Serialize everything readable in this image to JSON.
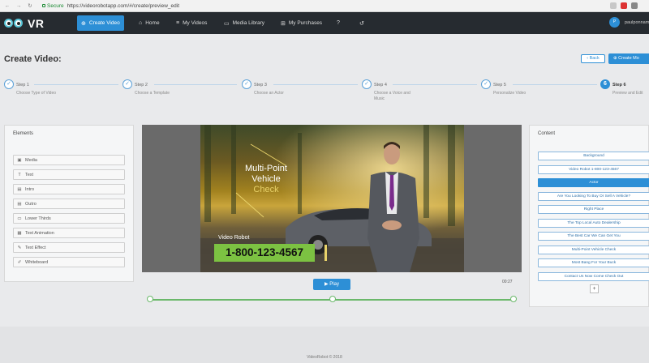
{
  "browser": {
    "secure_label": "Secure",
    "url": "https://videorobotapp.com/#/create/preview_edit"
  },
  "app": {
    "logo_text": "VR",
    "nav": [
      {
        "label": "Create Video",
        "icon": "plus-circle-icon",
        "active": true
      },
      {
        "label": "Home",
        "icon": "home-icon"
      },
      {
        "label": "My Videos",
        "icon": "list-icon"
      },
      {
        "label": "Media Library",
        "icon": "folder-icon"
      },
      {
        "label": "My Purchases",
        "icon": "cart-icon"
      },
      {
        "label": "",
        "icon": "help-icon"
      },
      {
        "label": "",
        "icon": "refresh-icon"
      }
    ],
    "user": {
      "avatar_initial": "P",
      "name": "paulponnam"
    }
  },
  "page": {
    "title": "Create Video:",
    "back_label": "Back",
    "create_label": "Create Mo"
  },
  "steps": [
    {
      "label": "Step 1",
      "desc": "Choose Type of Video",
      "done": true
    },
    {
      "label": "Step 2",
      "desc": "Choose a Template",
      "done": true
    },
    {
      "label": "Step 3",
      "desc": "Choose an Actor",
      "done": true
    },
    {
      "label": "Step 4",
      "desc": "Choose a Voice and Music",
      "done": true
    },
    {
      "label": "Step 5",
      "desc": "Personalize Video",
      "done": true
    },
    {
      "label": "Step 6",
      "number": "6",
      "desc": "Preview and Edit",
      "current": true
    }
  ],
  "elements_panel": {
    "title": "Elements",
    "items": [
      {
        "label": "Media",
        "icon": "image-icon"
      },
      {
        "label": "Text",
        "icon": "text-icon"
      },
      {
        "label": "Intro",
        "icon": "film-icon"
      },
      {
        "label": "Outro",
        "icon": "film-icon"
      },
      {
        "label": "Lower Thirds",
        "icon": "monitor-icon"
      },
      {
        "label": "Text Animation",
        "icon": "text-animation-icon"
      },
      {
        "label": "Text Effect",
        "icon": "pencil-icon"
      },
      {
        "label": "Whiteboard",
        "icon": "brush-icon"
      }
    ]
  },
  "preview": {
    "headline_lines": [
      "Multi-Point",
      "Vehicle",
      "Check"
    ],
    "lower_label": "Video Robot",
    "phone": "1-800-123-4567",
    "play_label": "Play",
    "timecode": "00:27"
  },
  "content_panel": {
    "title": "Content",
    "items": [
      {
        "label": "Background"
      },
      {
        "label": "Video Robot 1-800-123-4567"
      },
      {
        "label": "Actor",
        "selected": true
      },
      {
        "label": "Are You Looking To Buy Or Sell A Vehicle?"
      },
      {
        "label": "Right Place"
      },
      {
        "label": "The Top Local Auto Dealership"
      },
      {
        "label": "The Best Car We Can Get You"
      },
      {
        "label": "Multi-Point Vehicle Check"
      },
      {
        "label": "Most Bang For Your Buck"
      },
      {
        "label": "Contact Us Now Come Check Out"
      }
    ],
    "add_label": "+"
  },
  "footer": {
    "text": "VideoRobot © 2018"
  },
  "colors": {
    "accent": "#2d8fd6",
    "navbar": "#262b30",
    "phone_bg": "#7cc242",
    "headline_accent": "#e8d26a"
  }
}
